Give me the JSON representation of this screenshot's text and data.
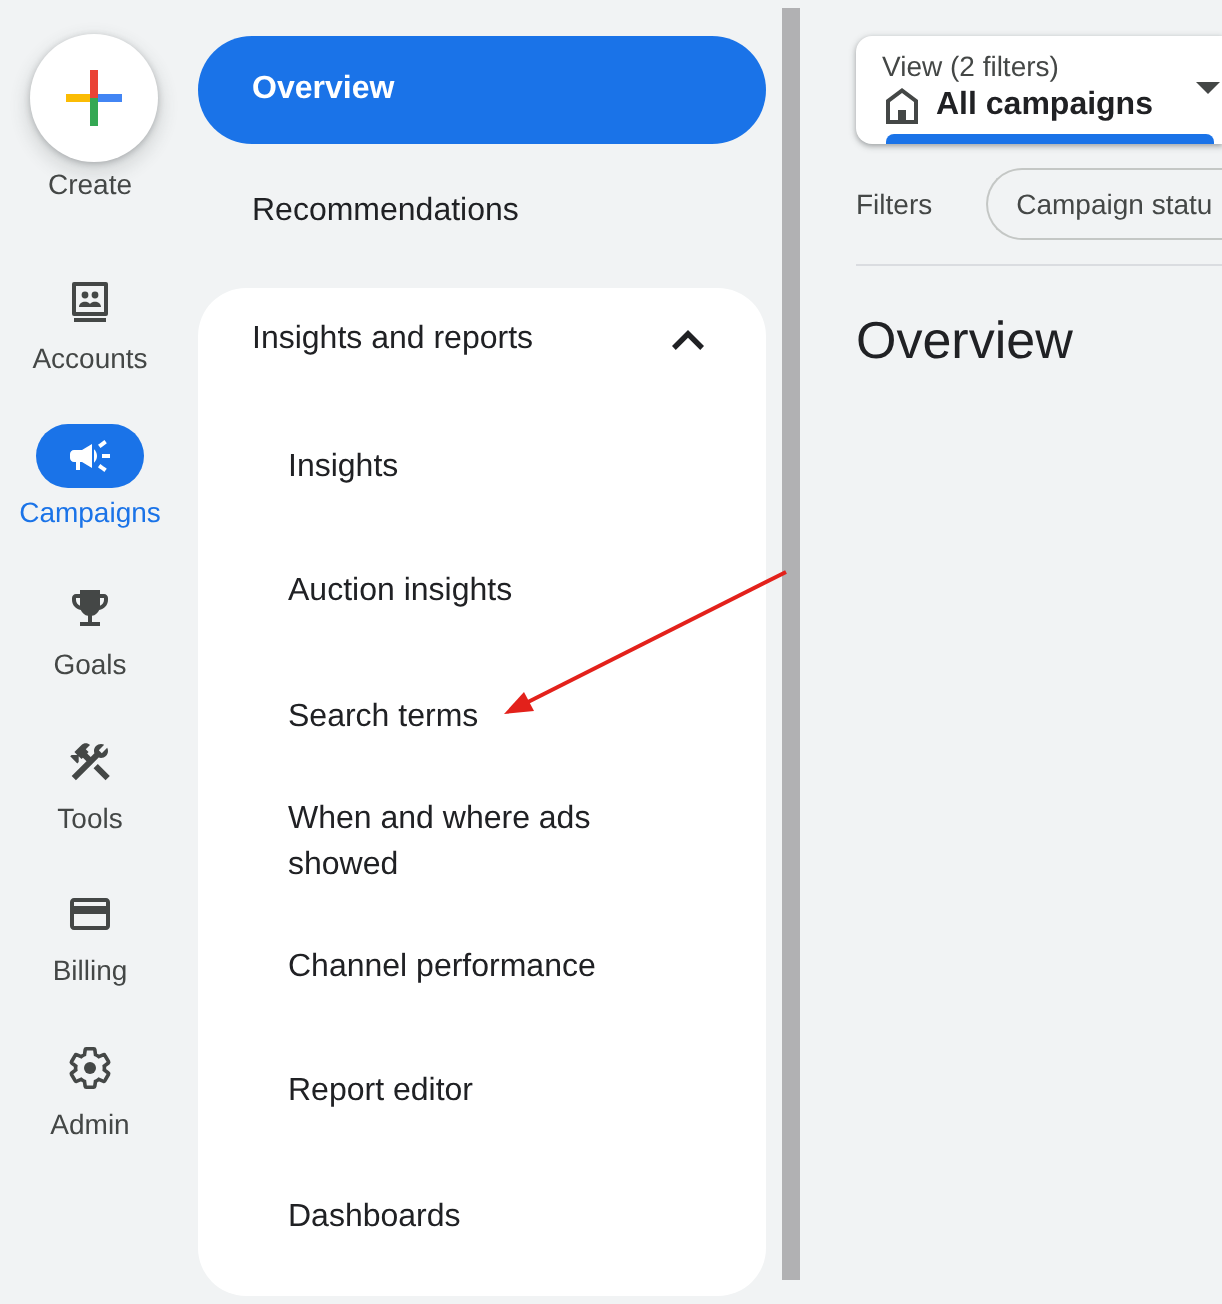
{
  "rail": {
    "create": {
      "label": "Create"
    },
    "items": [
      {
        "label": "Accounts",
        "selected": false
      },
      {
        "label": "Campaigns",
        "selected": true
      },
      {
        "label": "Goals",
        "selected": false
      },
      {
        "label": "Tools",
        "selected": false
      },
      {
        "label": "Billing",
        "selected": false
      },
      {
        "label": "Admin",
        "selected": false
      }
    ]
  },
  "nav": {
    "items": [
      {
        "label": "Overview",
        "selected": true
      },
      {
        "label": "Recommendations",
        "selected": false
      }
    ],
    "group": {
      "label": "Insights and reports",
      "expanded": true,
      "children": [
        {
          "label": "Insights",
          "selected": false
        },
        {
          "label": "Auction insights",
          "selected": false
        },
        {
          "label": "Search terms",
          "selected": false
        },
        {
          "label": "When and where ads showed",
          "selected": false
        },
        {
          "label": "Channel performance",
          "selected": false
        },
        {
          "label": "Report editor",
          "selected": false
        },
        {
          "label": "Dashboards",
          "selected": false
        }
      ]
    }
  },
  "view_selector": {
    "label": "View (2 filters)",
    "value": "All campaigns"
  },
  "filters": {
    "label": "Filters",
    "chips": [
      "Campaign statu"
    ]
  },
  "page_title": "Overview"
}
